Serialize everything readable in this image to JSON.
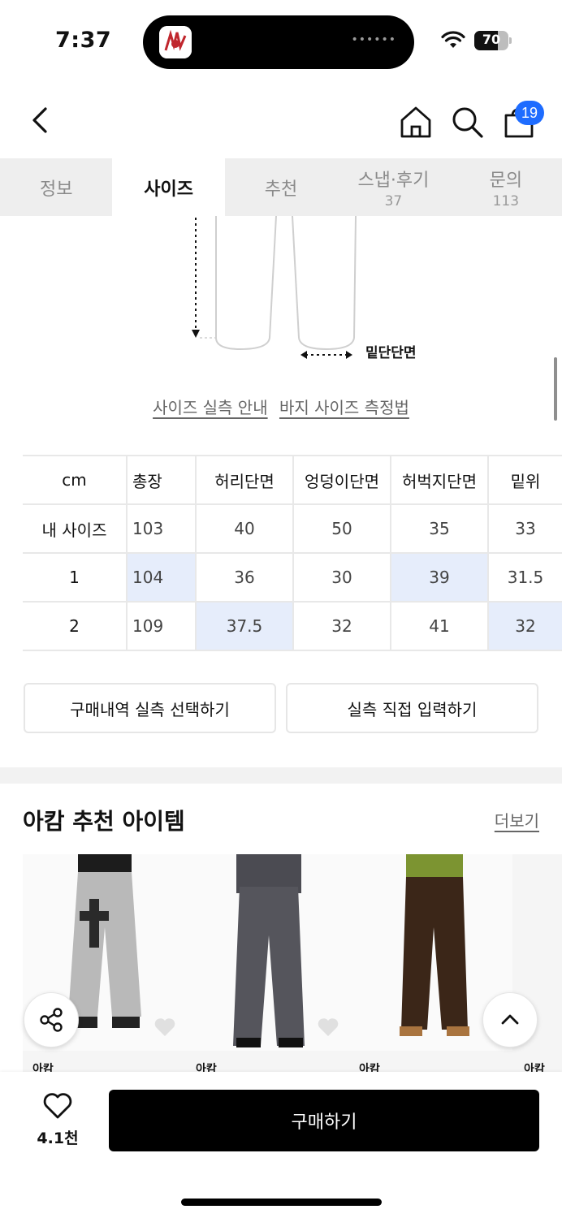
{
  "status": {
    "time": "7:37",
    "battery": "70",
    "battery_level": 0.7
  },
  "header": {
    "cart_count": "19"
  },
  "tabs": [
    {
      "label": "정보",
      "count": ""
    },
    {
      "label": "사이즈",
      "count": ""
    },
    {
      "label": "추천",
      "count": ""
    },
    {
      "label": "스냅·후기",
      "count": "37"
    },
    {
      "label": "문의",
      "count": "113"
    }
  ],
  "diagram": {
    "hem_label": "밑단단면"
  },
  "links": {
    "size_guide": "사이즈 실측 안내",
    "pants_measure": "바지 사이즈 측정법"
  },
  "size_table": {
    "headers": [
      "cm",
      "총장",
      "허리단면",
      "엉덩이단면",
      "허벅지단면",
      "밑위"
    ],
    "rows": [
      {
        "label": "내 사이즈",
        "values": [
          "103",
          "40",
          "50",
          "35",
          "33"
        ]
      },
      {
        "label": "1",
        "values": [
          "104",
          "36",
          "30",
          "39",
          "31.5"
        ]
      },
      {
        "label": "2",
        "values": [
          "109",
          "37.5",
          "32",
          "41",
          "32"
        ]
      }
    ]
  },
  "buttons": {
    "purchase_history": "구매내역 실측 선택하기",
    "manual_input": "실측 직접 입력하기"
  },
  "recommend": {
    "title": "아캄 추천 아이템",
    "more": "더보기",
    "products": [
      {
        "brand": "아캄"
      },
      {
        "brand": "아캄"
      },
      {
        "brand": "아캄"
      },
      {
        "brand": "아캄"
      }
    ]
  },
  "bottom": {
    "like_count": "4.1천",
    "buy_label": "구매하기"
  }
}
